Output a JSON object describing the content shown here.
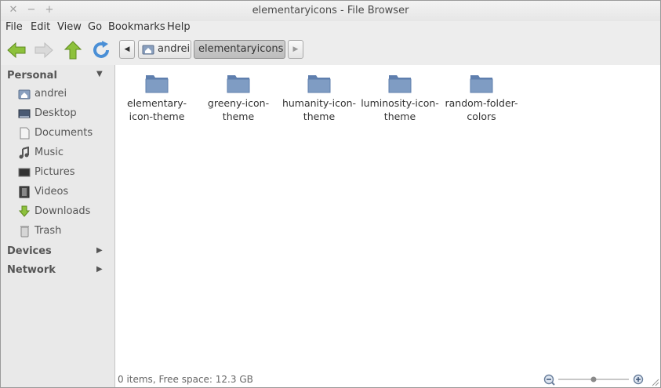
{
  "window": {
    "title": "elementaryicons - File Browser",
    "controls": [
      "close",
      "minimize",
      "maximize"
    ]
  },
  "menubar": {
    "items": [
      "File",
      "Edit",
      "View",
      "Go",
      "Bookmarks",
      "Help"
    ]
  },
  "toolbar": {
    "buttons": [
      "back-icon",
      "forward-icon",
      "up-icon",
      "reload-icon"
    ],
    "path": {
      "segments": [
        "andrei",
        "elementaryicons"
      ],
      "active": "elementaryicons"
    }
  },
  "sidebar": {
    "sections": [
      {
        "label": "Personal",
        "expanded": true,
        "items": [
          {
            "label": "andrei",
            "icon": "home-icon"
          },
          {
            "label": "Desktop",
            "icon": "desktop-icon"
          },
          {
            "label": "Documents",
            "icon": "documents-icon"
          },
          {
            "label": "Music",
            "icon": "music-icon"
          },
          {
            "label": "Pictures",
            "icon": "pictures-icon"
          },
          {
            "label": "Videos",
            "icon": "videos-icon"
          },
          {
            "label": "Downloads",
            "icon": "downloads-icon"
          },
          {
            "label": "Trash",
            "icon": "trash-icon"
          }
        ]
      },
      {
        "label": "Devices",
        "expanded": false
      },
      {
        "label": "Network",
        "expanded": false
      }
    ]
  },
  "files": [
    {
      "name_line1": "elementary-",
      "name_line2": "icon-theme"
    },
    {
      "name_line1": "greeny-icon-",
      "name_line2": "theme"
    },
    {
      "name_line1": "humanity-icon-",
      "name_line2": "theme"
    },
    {
      "name_line1": "luminosity-icon-",
      "name_line2": "theme"
    },
    {
      "name_line1": "random-folder-",
      "name_line2": "colors"
    }
  ],
  "status": {
    "text": "0 items, Free space: 12.3 GB",
    "zoom_level": 0.5
  },
  "colors": {
    "folder": "#7f9cc3",
    "arrow_green": "#8dc13c",
    "reload_blue": "#4a8fd6"
  }
}
